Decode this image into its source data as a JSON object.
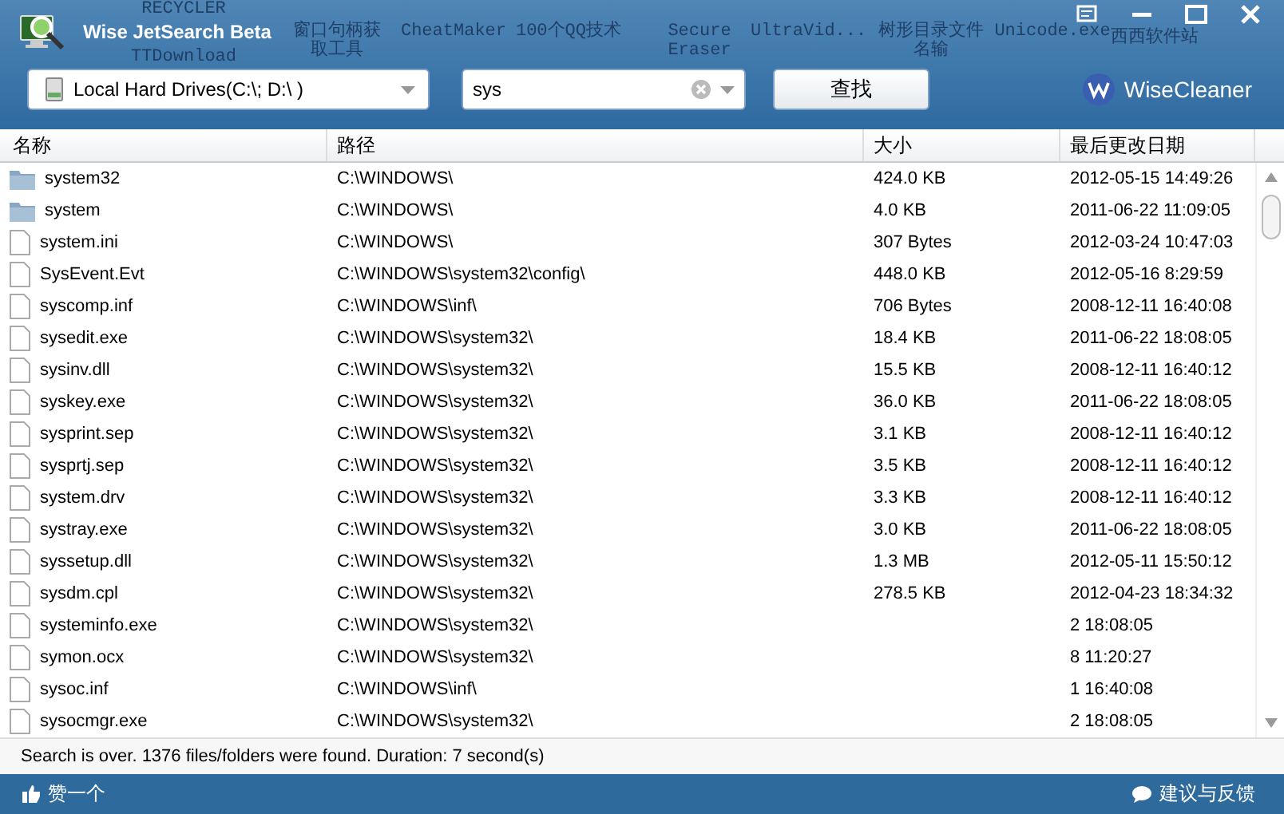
{
  "desktop": {
    "labels": [
      {
        "text": "RECYCLER"
      },
      {
        "text": "TTDownload"
      },
      {
        "text": "窗口句柄获取工具"
      },
      {
        "text": "CheatMaker"
      },
      {
        "text": "100个QQ技术"
      },
      {
        "text": "Secure Eraser"
      },
      {
        "text": "UltraVid..."
      },
      {
        "text": "树形目录文件名输"
      },
      {
        "text": "Unicode.exe"
      },
      {
        "text": "西西软件站"
      }
    ]
  },
  "window": {
    "title": "Wise JetSearch Beta"
  },
  "toolbar": {
    "drive": "Local Hard Drives(C:\\; D:\\ )",
    "search": {
      "value": "sys"
    },
    "find_button": "查找",
    "logo": "WiseCleaner"
  },
  "table": {
    "columns": [
      "名称",
      "路径",
      "大小",
      "最后更改日期"
    ],
    "rows": [
      {
        "kind": "folder",
        "name": "system32",
        "path": "C:\\WINDOWS\\",
        "size": "424.0 KB",
        "date": "2012-05-15 14:49:26"
      },
      {
        "kind": "folder",
        "name": "system",
        "path": "C:\\WINDOWS\\",
        "size": "4.0 KB",
        "date": "2011-06-22 11:09:05"
      },
      {
        "kind": "file",
        "name": "system.ini",
        "path": "C:\\WINDOWS\\",
        "size": "307 Bytes",
        "date": "2012-03-24 10:47:03"
      },
      {
        "kind": "file",
        "name": "SysEvent.Evt",
        "path": "C:\\WINDOWS\\system32\\config\\",
        "size": "448.0 KB",
        "date": "2012-05-16 8:29:59"
      },
      {
        "kind": "file",
        "name": "syscomp.inf",
        "path": "C:\\WINDOWS\\inf\\",
        "size": "706 Bytes",
        "date": "2008-12-11 16:40:08"
      },
      {
        "kind": "file",
        "name": "sysedit.exe",
        "path": "C:\\WINDOWS\\system32\\",
        "size": "18.4 KB",
        "date": "2011-06-22 18:08:05"
      },
      {
        "kind": "file",
        "name": "sysinv.dll",
        "path": "C:\\WINDOWS\\system32\\",
        "size": "15.5 KB",
        "date": "2008-12-11 16:40:12"
      },
      {
        "kind": "file",
        "name": "syskey.exe",
        "path": "C:\\WINDOWS\\system32\\",
        "size": "36.0 KB",
        "date": "2011-06-22 18:08:05"
      },
      {
        "kind": "file",
        "name": "sysprint.sep",
        "path": "C:\\WINDOWS\\system32\\",
        "size": "3.1 KB",
        "date": "2008-12-11 16:40:12"
      },
      {
        "kind": "file",
        "name": "sysprtj.sep",
        "path": "C:\\WINDOWS\\system32\\",
        "size": "3.5 KB",
        "date": "2008-12-11 16:40:12"
      },
      {
        "kind": "file",
        "name": "system.drv",
        "path": "C:\\WINDOWS\\system32\\",
        "size": "3.3 KB",
        "date": "2008-12-11 16:40:12"
      },
      {
        "kind": "file",
        "name": "systray.exe",
        "path": "C:\\WINDOWS\\system32\\",
        "size": "3.0 KB",
        "date": "2011-06-22 18:08:05"
      },
      {
        "kind": "file",
        "name": "syssetup.dll",
        "path": "C:\\WINDOWS\\system32\\",
        "size": "1.3 MB",
        "date": "2012-05-11 15:50:12"
      },
      {
        "kind": "file",
        "name": "sysdm.cpl",
        "path": "C:\\WINDOWS\\system32\\",
        "size": "278.5 KB",
        "date": "2012-04-23 18:34:32"
      },
      {
        "kind": "file",
        "name": "systeminfo.exe",
        "path": "C:\\WINDOWS\\system32\\",
        "date": "2 18:08:05"
      },
      {
        "kind": "file",
        "name": "symon.ocx",
        "path": "C:\\WINDOWS\\system32\\",
        "date": "8 11:20:27"
      },
      {
        "kind": "file",
        "name": "sysoc.inf",
        "path": "C:\\WINDOWS\\inf\\",
        "date": "1 16:40:08"
      },
      {
        "kind": "file",
        "name": "sysocmgr.exe",
        "path": "C:\\WINDOWS\\system32\\",
        "date": "2 18:08:05"
      }
    ]
  },
  "status": "Search is over. 1376 files/folders were found. Duration: 7 second(s)",
  "footer": {
    "like": "赞一个",
    "feedback": "建议与反馈"
  }
}
